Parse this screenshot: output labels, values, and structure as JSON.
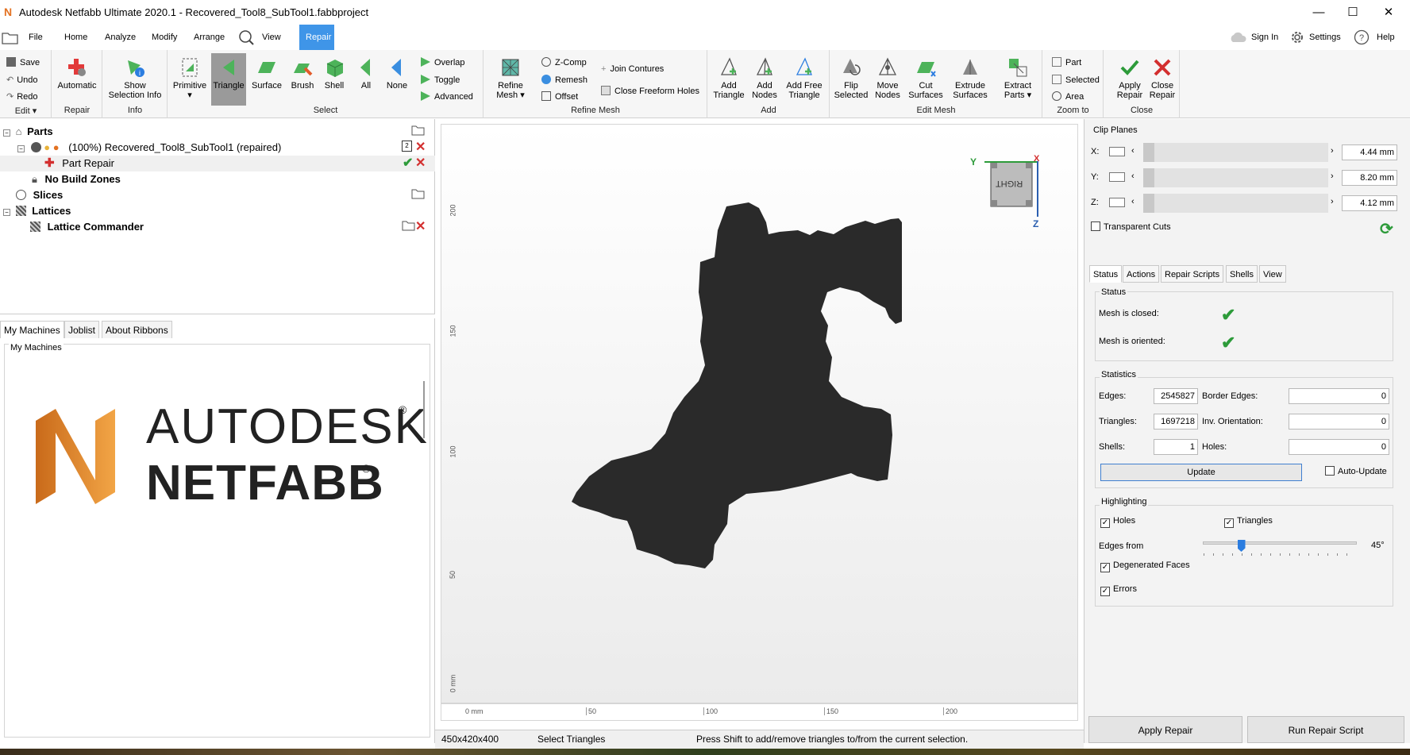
{
  "window": {
    "title": "Autodesk Netfabb Ultimate 2020.1 - Recovered_Tool8_SubTool1.fabbproject",
    "logo": "N",
    "minimize": "—",
    "maximize": "☐",
    "close": "✕"
  },
  "tabs": {
    "file": "File",
    "home": "Home",
    "analyze": "Analyze",
    "modify": "Modify",
    "arrange": "Arrange",
    "view": "View",
    "repair": "Repair",
    "sign_in": "Sign In",
    "settings": "Settings",
    "help": "Help"
  },
  "ribbon": {
    "edit": {
      "save": "Save",
      "undo": "Undo",
      "redo": "Redo",
      "group": "Edit ▾"
    },
    "repair": {
      "automatic": "Automatic",
      "group": "Repair"
    },
    "info": {
      "show_selection_info_1": "Show",
      "show_selection_info_2": "Selection Info",
      "group": "Info"
    },
    "select": {
      "primitive": "Primitive",
      "triangle": "Triangle",
      "surface": "Surface",
      "brush": "Brush",
      "shell": "Shell",
      "all": "All",
      "none": "None",
      "overlap": "Overlap",
      "toggle": "Toggle",
      "advanced": "Advanced",
      "group": "Select"
    },
    "refine": {
      "refine_mesh_1": "Refine",
      "refine_mesh_2": "Mesh ▾",
      "zcomp": "Z-Comp",
      "remesh": "Remesh",
      "offset": "Offset",
      "join_contures": "Join Contures",
      "close_freeform_holes": "Close Freeform Holes",
      "group": "Refine Mesh"
    },
    "add": {
      "add_triangle_1": "Add",
      "add_triangle_2": "Triangle",
      "add_nodes_1": "Add",
      "add_nodes_2": "Nodes",
      "add_free_triangle_1": "Add Free",
      "add_free_triangle_2": "Triangle",
      "group": "Add"
    },
    "edit_mesh": {
      "flip_1": "Flip",
      "flip_2": "Selected",
      "move_1": "Move",
      "move_2": "Nodes",
      "cut_1": "Cut",
      "cut_2": "Surfaces",
      "extrude_1": "Extrude",
      "extrude_2": "Surfaces",
      "extract_1": "Extract",
      "extract_2": "Parts ▾",
      "group": "Edit Mesh"
    },
    "zoom": {
      "part": "Part",
      "selected": "Selected",
      "area": "Area",
      "group": "Zoom to"
    },
    "close": {
      "apply_1": "Apply",
      "apply_2": "Repair",
      "close_1": "Close",
      "close_2": "Repair",
      "group": "Close"
    }
  },
  "tree": {
    "parts": "Parts",
    "part_item": "(100%) Recovered_Tool8_SubTool1 (repaired)",
    "part_badge": "2",
    "part_repair": "Part Repair",
    "no_build_zones": "No Build Zones",
    "slices": "Slices",
    "lattices": "Lattices",
    "lattice_commander": "Lattice Commander"
  },
  "machines": {
    "tab_my_machines": "My Machines",
    "tab_joblist": "Joblist",
    "tab_about_ribbons": "About Ribbons",
    "group_label": "My Machines",
    "brand_1": "AUTODESK",
    "brand_2": "NETFABB",
    "reg": "®"
  },
  "viewport": {
    "ruler_left": [
      "200",
      "150",
      "100",
      "50",
      "0 mm"
    ],
    "ruler_bottom": [
      "0 mm",
      "50",
      "100",
      "150",
      "200"
    ],
    "cube_face": "RIGHT",
    "axis_y": "Y",
    "axis_z": "Z",
    "axis_x": "X"
  },
  "clip": {
    "title": "Clip Planes",
    "x_label": "X:",
    "x_value": "4.44 mm",
    "y_label": "Y:",
    "y_value": "8.20 mm",
    "z_label": "Z:",
    "z_value": "4.12 mm",
    "transparent_cuts": "Transparent Cuts"
  },
  "panel_tabs": {
    "status": "Status",
    "actions": "Actions",
    "repair_scripts": "Repair Scripts",
    "shells": "Shells",
    "view": "View"
  },
  "status": {
    "title": "Status",
    "mesh_closed": "Mesh is closed:",
    "mesh_oriented": "Mesh is oriented:"
  },
  "statistics": {
    "title": "Statistics",
    "edges_label": "Edges:",
    "edges_value": "2545827",
    "border_edges_label": "Border Edges:",
    "border_edges_value": "0",
    "triangles_label": "Triangles:",
    "triangles_value": "1697218",
    "inv_orientation_label": "Inv. Orientation:",
    "inv_orientation_value": "0",
    "shells_label": "Shells:",
    "shells_value": "1",
    "holes_label": "Holes:",
    "holes_value": "0",
    "update": "Update",
    "auto_update": "Auto-Update"
  },
  "highlighting": {
    "title": "Highlighting",
    "holes": "Holes",
    "triangles": "Triangles",
    "edges_from": "Edges from",
    "edges_from_value": "45°",
    "edges_from_fraction": 0.25,
    "degenerated_faces": "Degenerated Faces",
    "errors": "Errors"
  },
  "bottom_buttons": {
    "apply_repair": "Apply Repair",
    "run_repair_script": "Run Repair Script"
  },
  "statusbar": {
    "dims": "450x420x400",
    "mode": "Select Triangles",
    "hint": "Press Shift to add/remove triangles to/from the current selection."
  },
  "colors": {
    "accent": "#3f95e8",
    "check_green": "#2d9b3a",
    "close_red": "#d32f2f",
    "brand_orange": "#e37222",
    "mesh": "#2a2a2a"
  }
}
